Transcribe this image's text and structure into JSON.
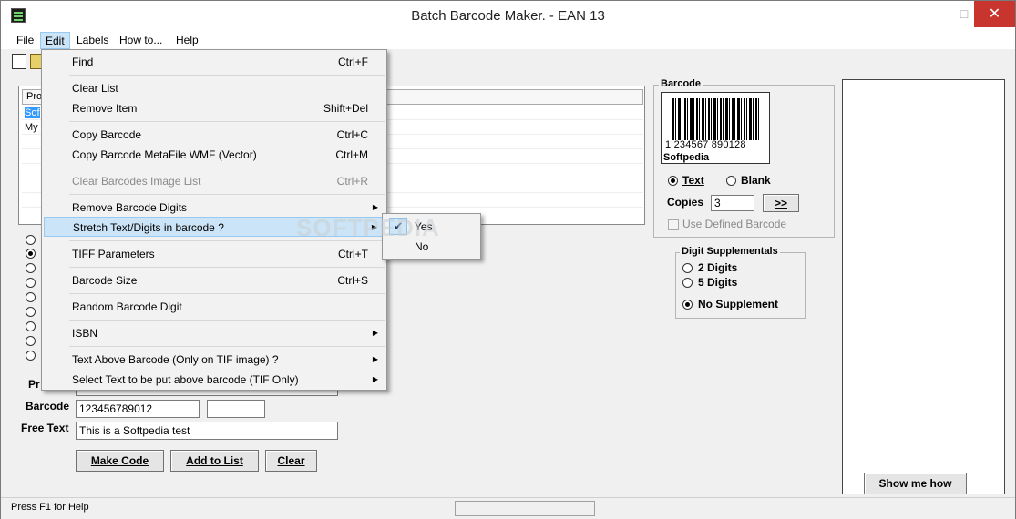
{
  "window": {
    "title": "Batch Barcode Maker.  - EAN 13",
    "minimize": "–",
    "maximize": "□",
    "close": "✕"
  },
  "menubar": [
    "File",
    "Edit",
    "Labels",
    "How to...",
    "Help"
  ],
  "list": {
    "header": "Pro",
    "rows": [
      "Sof",
      "My"
    ]
  },
  "left_form": {
    "product_label": "Pr",
    "barcode_label": "Barcode",
    "barcode_value": "123456789012",
    "barcode_extra": "",
    "freetext_label": "Free Text",
    "freetext_value": "This is a Softpedia test",
    "buttons": {
      "make_code": "Make Code",
      "add_to_list": "Add to List",
      "clear": "Clear"
    }
  },
  "barcode_group": {
    "title": "Barcode",
    "preview_digits": "1  234567  890128",
    "preview_caption": "Softpedia",
    "text_option": "Text",
    "blank_option": "Blank",
    "copies_label": "Copies",
    "copies_value": "3",
    "next_button": ">>",
    "use_defined": "Use Defined Barcode"
  },
  "digit_group": {
    "title": "Digit Supplementals",
    "options": [
      "2 Digits",
      "5 Digits",
      "No Supplement"
    ]
  },
  "show_me_how": "Show me how",
  "status": {
    "help": "Press F1 for Help"
  },
  "edit_menu": {
    "find": {
      "label": "Find",
      "shortcut": "Ctrl+F"
    },
    "clear_list": {
      "label": "Clear List"
    },
    "remove_item": {
      "label": "Remove Item",
      "shortcut": "Shift+Del"
    },
    "copy_barcode": {
      "label": "Copy Barcode",
      "shortcut": "Ctrl+C"
    },
    "copy_wmf": {
      "label": "Copy Barcode MetaFile WMF (Vector)",
      "shortcut": "Ctrl+M"
    },
    "clear_images": {
      "label": "Clear Barcodes Image List",
      "shortcut": "Ctrl+R"
    },
    "remove_digits": {
      "label": "Remove Barcode Digits"
    },
    "stretch": {
      "label": "Stretch Text/Digits in barcode ?"
    },
    "tiff": {
      "label": "TIFF Parameters",
      "shortcut": "Ctrl+T"
    },
    "size": {
      "label": "Barcode Size",
      "shortcut": "Ctrl+S"
    },
    "random": {
      "label": "Random Barcode Digit"
    },
    "isbn": {
      "label": "ISBN"
    },
    "text_above": {
      "label": "Text Above Barcode (Only on TIF image) ?"
    },
    "select_text": {
      "label": "Select Text to be put above barcode (TIF Only)"
    }
  },
  "stretch_submenu": [
    "Yes",
    "No"
  ],
  "watermark": "SOFTPEDIA"
}
